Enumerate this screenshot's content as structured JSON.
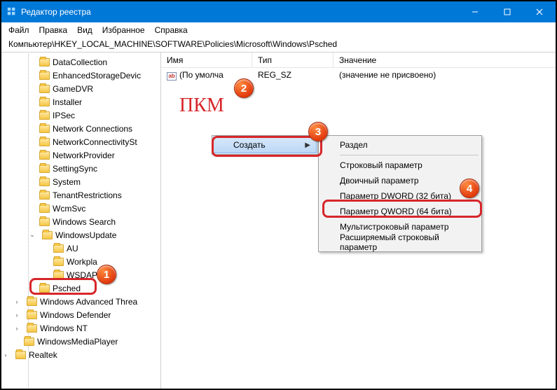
{
  "window": {
    "title": "Редактор реестра"
  },
  "menu": {
    "file": "Файл",
    "edit": "Правка",
    "view": "Вид",
    "favorites": "Избранное",
    "help": "Справка"
  },
  "address": "Компьютер\\HKEY_LOCAL_MACHINE\\SOFTWARE\\Policies\\Microsoft\\Windows\\Psched",
  "columns": {
    "name": "Имя",
    "type": "Тип",
    "value": "Значение"
  },
  "row0": {
    "name": "(По умолча",
    "type": "REG_SZ",
    "value": "(значение не присвоено)"
  },
  "tree": {
    "items": [
      "DataCollection",
      "EnhancedStorageDevic",
      "GameDVR",
      "Installer",
      "IPSec",
      "Network Connections",
      "NetworkConnectivitySt",
      "NetworkProvider",
      "SettingSync",
      "System",
      "TenantRestrictions",
      "WcmSvc",
      "Windows Search",
      "WindowsUpdate",
      "AU",
      "Workpla",
      "WSDAP",
      "Psched",
      "Windows Advanced Threa",
      "Windows Defender",
      "Windows NT",
      "WindowsMediaPlayer",
      "Realtek"
    ]
  },
  "pkm": "ПКМ",
  "context": {
    "create": "Создать",
    "section": "Раздел",
    "string": "Строковый параметр",
    "binary": "Двоичный параметр",
    "dword": "Параметр DWORD (32 бита)",
    "qword": "Параметр QWORD (64 бита)",
    "multi": "Мультистроковый параметр",
    "expand": "Расширяемый строковый параметр"
  },
  "badges": {
    "b1": "1",
    "b2": "2",
    "b3": "3",
    "b4": "4"
  }
}
